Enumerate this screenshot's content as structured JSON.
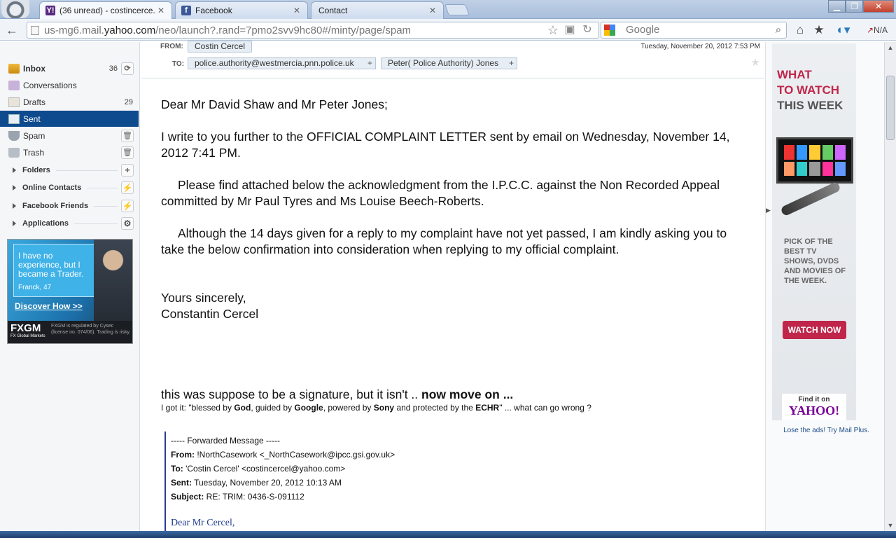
{
  "browser": {
    "tabs": [
      {
        "title": "(36 unread) - costincerce...",
        "favicon": "Y!",
        "color": "#5a2a82"
      },
      {
        "title": "Facebook",
        "favicon": "f",
        "color": "#3b5998"
      },
      {
        "title": "Contact",
        "favicon": "",
        "color": ""
      }
    ],
    "window_buttons": {
      "minimize": "▁",
      "maximize": "❐",
      "close": "✕"
    },
    "url_prefix": "us-mg6.mail.",
    "url_domain": "yahoo.com",
    "url_suffix": "/neo/launch?.rand=7pmo2svv9hc80#/minty/page/spam",
    "search_placeholder": "Google",
    "addon_text": "N/A"
  },
  "sidebar": {
    "folders": [
      {
        "label": "Inbox",
        "count": "36",
        "action": "⟳",
        "icon": "inbox-icon",
        "bold": true
      },
      {
        "label": "Conversations",
        "count": "",
        "action": "",
        "icon": "conversations-icon"
      },
      {
        "label": "Drafts",
        "count": "29",
        "action": "",
        "icon": "drafts-icon"
      },
      {
        "label": "Sent",
        "count": "",
        "action": "",
        "icon": "sent-icon",
        "selected": true
      },
      {
        "label": "Spam",
        "count": "",
        "action": "🗑",
        "icon": "spam-shield-icon"
      },
      {
        "label": "Trash",
        "count": "",
        "action": "🗑",
        "icon": "trash-icon"
      }
    ],
    "sections": [
      {
        "label": "Folders",
        "action": "+"
      },
      {
        "label": "Online Contacts",
        "action": "⚡"
      },
      {
        "label": "Facebook Friends",
        "action": "⚡"
      },
      {
        "label": "Applications",
        "action": "⚙"
      }
    ],
    "ad": {
      "quote": "I have no experience, but I became a Trader.",
      "name": "Franck, 47",
      "cta": "Discover How >>",
      "brand": "FXGM",
      "brand_sub": "FX Global Markets",
      "disclaimer": "FXGM is regulated by Cysec (license no. 074/06). Trading is risky."
    }
  },
  "message": {
    "from_label": "FROM:",
    "from": "Costin Cercel",
    "date": "Tuesday, November 20, 2012 7:53 PM",
    "to_label": "TO:",
    "to": [
      "police.authority@westmercia.pnn.police.uk",
      "Peter( Police Authority) Jones"
    ],
    "paragraphs": [
      "Dear Mr David Shaw and Mr Peter Jones;",
      "I write to you further to the OFFICIAL COMPLAINT LETTER sent by email on Wednesday, November 14, 2012 7:41 PM.",
      "Please find attached below the acknowledgment from the I.P.C.C. against the Non Recorded Appeal committed by Mr Paul Tyres and Ms Louise Beech-Roberts.",
      "Although the 14 days given for a reply to my complaint have not yet passed, I am kindly asking you to take the below confirmation into consideration when replying to my official complaint.",
      "Yours sincerely,",
      "Constantin Cercel"
    ],
    "sig_text": "this was suppose to be a signature, but it isn't .. ",
    "sig_bold": "now move on ...",
    "tagline_parts": [
      "I got it: \"blessed by ",
      "God",
      ", guided by ",
      "Google",
      ", powered by ",
      "Sony",
      " and protected by the ",
      "ECHR",
      "\" ... what can go wrong ?"
    ],
    "forwarded": {
      "header": "----- Forwarded Message -----",
      "from_label": "From:",
      "from": " !NorthCasework <_NorthCasework@ipcc.gsi.gov.uk>",
      "to_label": "To:",
      "to": " 'Costin Cercel' <costincercel@yahoo.com>",
      "sent_label": "Sent:",
      "sent": " Tuesday, November 20, 2012 10:13 AM",
      "subject_label": "Subject:",
      "subject": " RE: TRIM: 0436-S-091112",
      "greeting": "Dear Mr Cercel,"
    }
  },
  "right_ad": {
    "headline1": "WHAT",
    "headline2": "TO WATCH",
    "headline3": "THIS WEEK",
    "body": "PICK OF THE BEST TV SHOWS, DVDS AND MOVIES OF THE WEEK.",
    "cta": "WATCH NOW",
    "findit": "Find it on",
    "yahoo": "YAHOO!",
    "lose_ads": "Lose the ads! Try Mail Plus."
  },
  "colors": {
    "selected": "#0e4a8e",
    "accent_red": "#c0264a",
    "yahoo_purple": "#7b0099"
  }
}
